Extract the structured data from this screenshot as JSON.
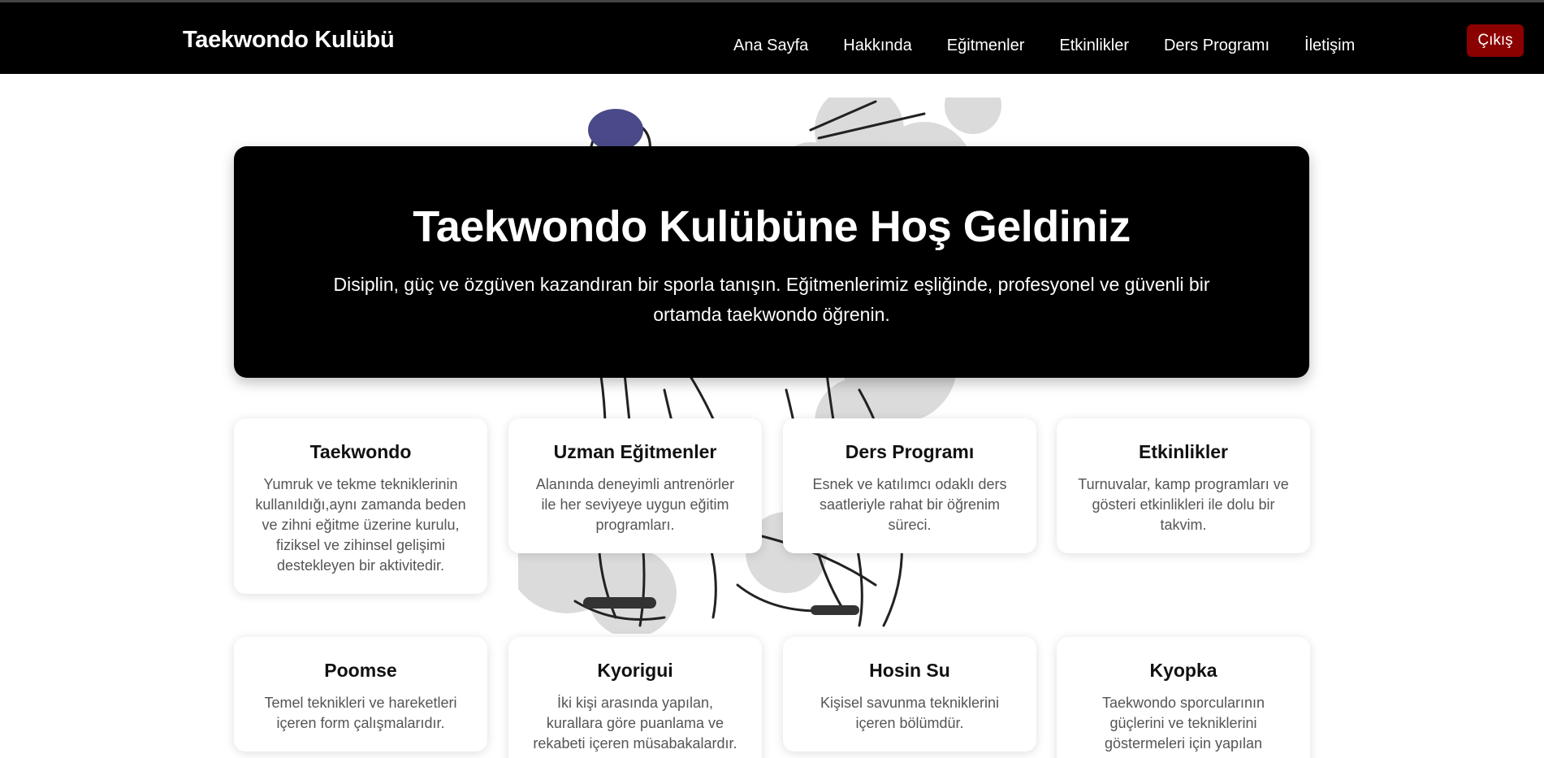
{
  "navbar": {
    "brand": "Taekwondo Kulübü",
    "links": [
      "Ana Sayfa",
      "Hakkında",
      "Eğitmenler",
      "Etkinlikler",
      "Ders Programı",
      "İletişim"
    ],
    "logout_label": "Çıkış"
  },
  "hero": {
    "title": "Taekwondo Kulübüne Hoş Geldiniz",
    "subtitle": "Disiplin, güç ve özgüven kazandıran bir sporla tanışın. Eğitmenlerimiz eşliğinde, profesyonel ve güvenli bir ortamda taekwondo öğrenin."
  },
  "cards": [
    {
      "title": "Taekwondo",
      "text": "Yumruk ve tekme tekniklerinin kullanıldığı,aynı zamanda beden ve zihni eğitme üzerine kurulu, fiziksel ve zihinsel gelişimi destekleyen bir aktivitedir."
    },
    {
      "title": "Uzman Eğitmenler",
      "text": "Alanında deneyimli antrenörler ile her seviyeye uygun eğitim programları."
    },
    {
      "title": "Ders Programı",
      "text": "Esnek ve katılımcı odaklı ders saatleriyle rahat bir öğrenim süreci."
    },
    {
      "title": "Etkinlikler",
      "text": "Turnuvalar, kamp programları ve gösteri etkinlikleri ile dolu bir takvim."
    },
    {
      "title": "Poomse",
      "text": "Temel teknikleri ve hareketleri içeren form çalışmalarıdır."
    },
    {
      "title": "Kyorigui",
      "text": "İki kişi arasında yapılan, kurallara göre puanlama ve rekabeti içeren müsabakalardır."
    },
    {
      "title": "Hosin Su",
      "text": "Kişisel savunma tekniklerini içeren bölümdür."
    },
    {
      "title": "Kyopka",
      "text": "Taekwondo sporcularının güçlerini ve tekniklerini göstermeleri için yapılan"
    }
  ]
}
